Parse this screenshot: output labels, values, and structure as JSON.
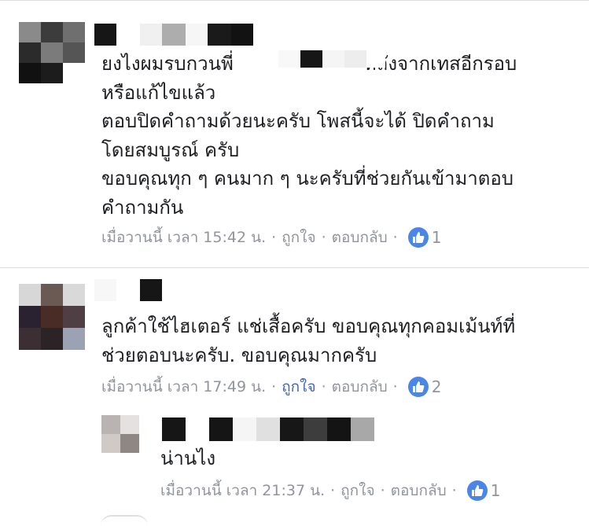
{
  "comments": [
    {
      "lines": [
        "ยงไงผมรบกวนพี่",
        "หรือแก้ไขแล้ว",
        "ตอบปิดคำถามด้วยนะครับ   โพสนี้จะได้  ปิดคำถาม",
        "โดยสมบูรณ์  ครับ",
        "ขอบคุณทุก ๆ คนมาก ๆ นะครับที่ช่วยกันเข้ามาตอบ",
        "คำถามกัน"
      ],
      "line1_tail": "หลังจากเทสอีกรอบ",
      "timestamp": "เมื่อวานนี้ เวลา 15:42 น.",
      "like_label": "ถูกใจ",
      "reply_label": "ตอบกลับ",
      "like_count": "1"
    },
    {
      "lines": [
        "ลูกค้าใช้ไฮเตอร์ แช่เสื้อครับ ขอบคุณทุกคอมเม้นท์ที่",
        "ช่วยตอบนะครับ. ขอบคุณมากครับ"
      ],
      "timestamp": "เมื่อวานนี้ เวลา 17:49 น.",
      "like_label": "ถูกใจ",
      "reply_label": "ตอบกลับ",
      "like_count": "2"
    },
    {
      "lines": [
        "น่านไง"
      ],
      "timestamp": "เมื่อวานนี้ เวลา 21:37 น.",
      "like_label": "ถูกใจ",
      "reply_label": "ตอบกลับ",
      "like_count": "1"
    }
  ],
  "separator": "·",
  "colors": {
    "link": "#4267b2",
    "meta": "#90949c",
    "text": "#1c1e21",
    "like_badge": "#4a86e8"
  },
  "icons": {
    "like": "thumbs-up-icon"
  }
}
